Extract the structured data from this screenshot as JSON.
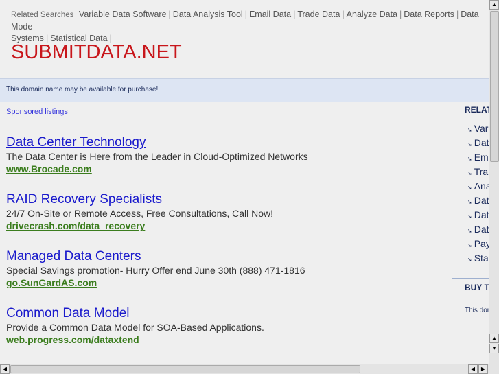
{
  "header": {
    "related_label": "Related Searches",
    "related_links": [
      "Variable Data Software",
      "Data Analysis Tool",
      "Email Data",
      "Trade Data",
      "Analyze Data",
      "Data Reports",
      "Data Mode",
      "Systems",
      "Statistical Data"
    ],
    "separator": "|",
    "logo": "SUBMITDATA.NET"
  },
  "notice": "This domain name may be available for purchase!",
  "main": {
    "sponsored_label": "Sponsored listings",
    "ads": [
      {
        "title": "Data Center Technology",
        "desc": "The Data Center is Here from the Leader in Cloud-Optimized Networks",
        "url": "www.Brocade.com"
      },
      {
        "title": "RAID Recovery Specialists",
        "desc": "24/7 On-Site or Remote Access, Free Consultations, Call Now!",
        "url": "drivecrash.com/data_recovery"
      },
      {
        "title": "Managed Data Centers",
        "desc": "Special Savings promotion- Hurry Offer end June 30th (888) 471-1816",
        "url": "go.SunGardAS.com"
      },
      {
        "title": "Common Data Model",
        "desc": "Provide a Common Data Model for SOA-Based Applications.",
        "url": "web.progress.com/dataxtend"
      }
    ]
  },
  "sidebar": {
    "heading": "RELAT",
    "items": [
      "Var",
      "Dat",
      "Em",
      "Tra",
      "Ana",
      "Dat",
      "Dat",
      "Dat",
      "Pay",
      "Sta"
    ],
    "buy_heading": "BUY T",
    "buy_text": "This dom"
  },
  "scroll": {
    "up": "▲",
    "down": "▼",
    "left": "◀",
    "right": "▶"
  }
}
